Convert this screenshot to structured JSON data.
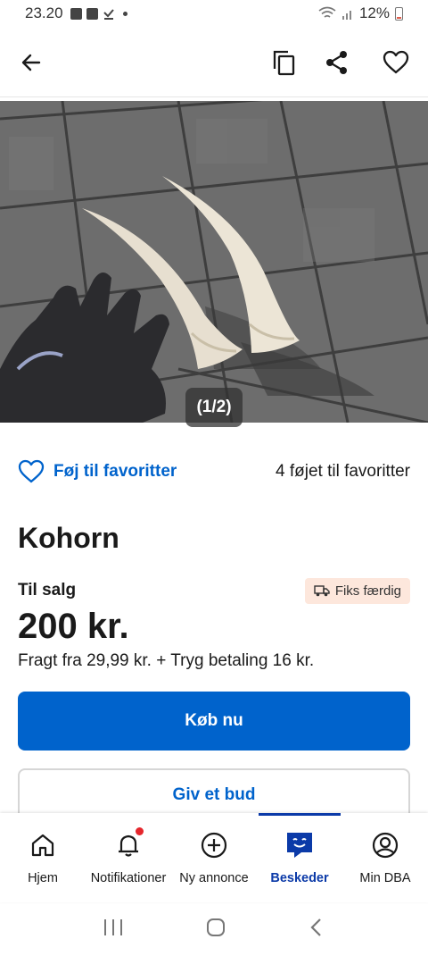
{
  "status_bar": {
    "time": "23.20",
    "battery": "12%"
  },
  "top_nav": {
    "back_icon": "back-arrow-icon",
    "copy_icon": "copy-icon",
    "share_icon": "share-icon",
    "favorite_icon": "heart-icon"
  },
  "gallery": {
    "counter": "(1/2)"
  },
  "favorites": {
    "add_label": "Føj til favoritter",
    "count_label": "4 føjet til favoritter"
  },
  "listing": {
    "title": "Kohorn",
    "status": "Til salg",
    "badge": "Fiks færdig",
    "price": "200 kr.",
    "shipping": "Fragt fra 29,99 kr. + Tryg betaling 16 kr."
  },
  "actions": {
    "buy_label": "Køb nu",
    "bid_label": "Giv et bud"
  },
  "bottom_nav": {
    "items": [
      {
        "label": "Hjem",
        "icon": "home-icon"
      },
      {
        "label": "Notifikationer",
        "icon": "bell-icon"
      },
      {
        "label": "Ny annonce",
        "icon": "plus-circle-icon"
      },
      {
        "label": "Beskeder",
        "icon": "chat-icon"
      },
      {
        "label": "Min DBA",
        "icon": "profile-icon"
      }
    ],
    "active": "Beskeder"
  },
  "colors": {
    "primary": "#0063cc",
    "active_nav": "#0b3aa8",
    "badge_bg": "#fde7dc",
    "notification_dot": "#e5262c"
  }
}
